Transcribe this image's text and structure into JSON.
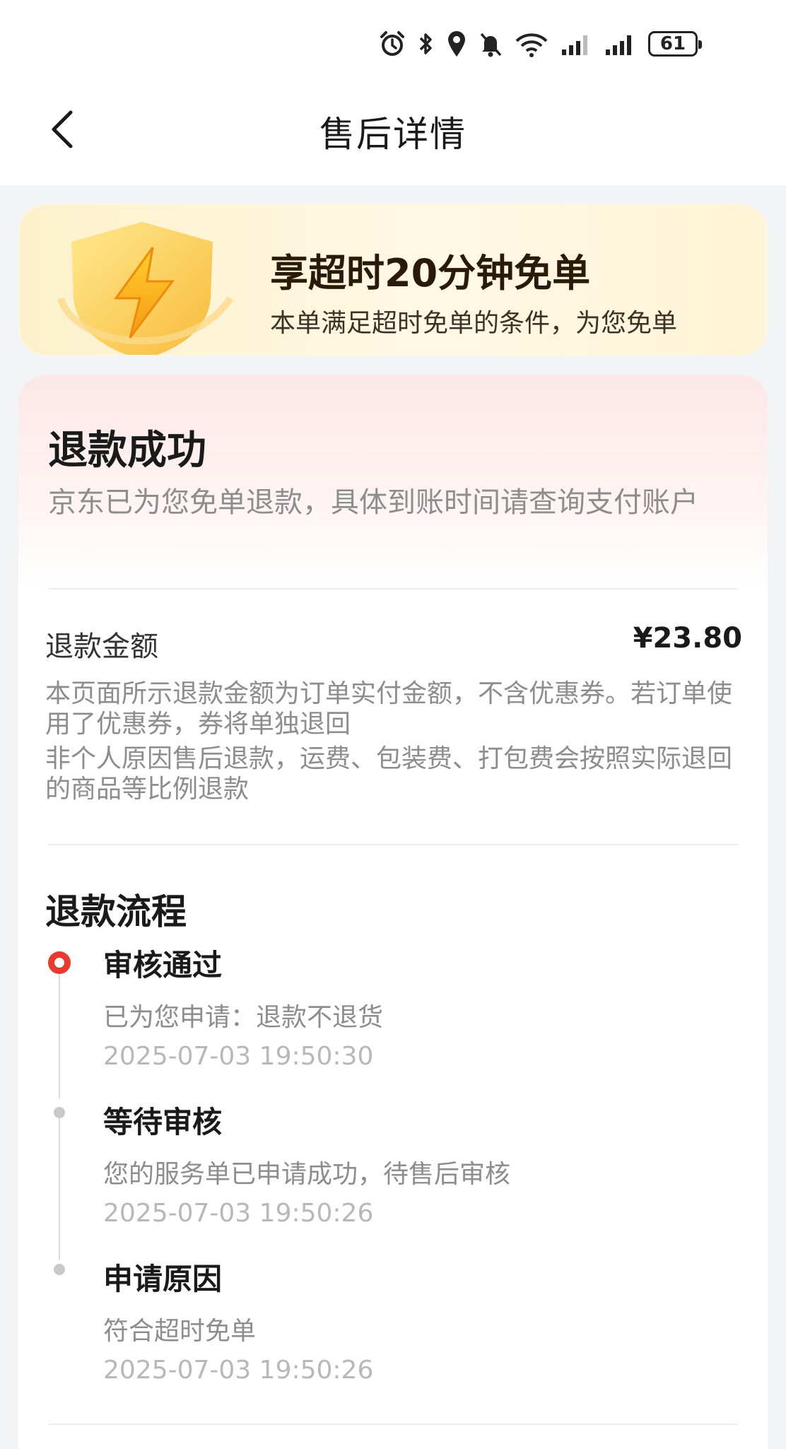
{
  "status_bar": {
    "battery": "61"
  },
  "header": {
    "title": "售后详情"
  },
  "promo": {
    "title": "享超时20分钟免单",
    "subtitle": "本单满足超时免单的条件，为您免单"
  },
  "refund_status": {
    "title": "退款成功",
    "description": "京东已为您免单退款，具体到账时间请查询支付账户"
  },
  "refund_amount": {
    "label": "退款金额",
    "value": "¥23.80",
    "notes": [
      "本页面所示退款金额为订单实付金额，不含优惠券。若订单使用了优惠券，券将单独退回",
      "非个人原因售后退款，运费、包装费、打包费会按照实际退回的商品等比例退款"
    ]
  },
  "refund_flow": {
    "title": "退款流程",
    "steps": [
      {
        "title": "审核通过",
        "desc": "已为您申请：退款不退货",
        "time": "2025-07-03 19:50:30"
      },
      {
        "title": "等待审核",
        "desc": "您的服务单已申请成功，待售后审核",
        "time": "2025-07-03 19:50:26"
      },
      {
        "title": "申请原因",
        "desc": "符合超时免单",
        "time": "2025-07-03 19:50:26"
      }
    ]
  },
  "colors": {
    "accent_red": "#e93a2f",
    "promo_bg": "#fdf1cc",
    "muted_text": "#8d8d8d"
  }
}
